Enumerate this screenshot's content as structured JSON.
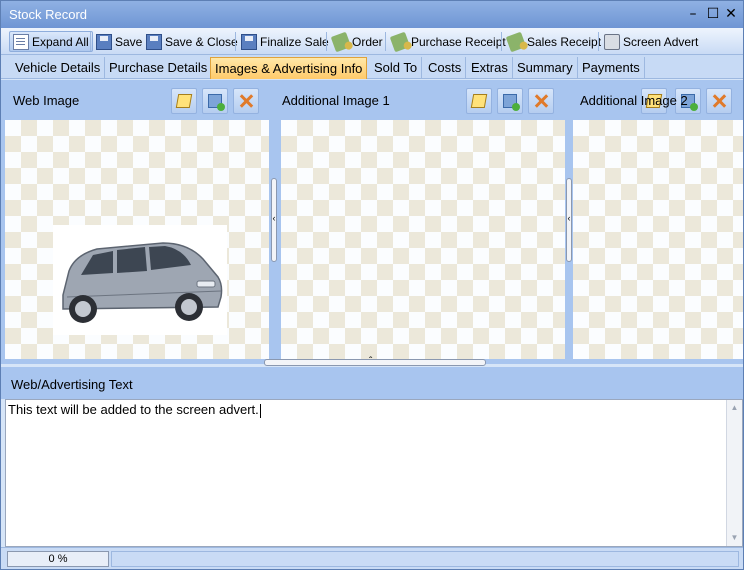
{
  "window": {
    "title": "Stock Record",
    "controls": [
      "minimize",
      "maximize",
      "close"
    ]
  },
  "toolbar": {
    "buttons": [
      {
        "label": "Expand All",
        "icon": "document-icon"
      },
      {
        "label": "Save",
        "icon": "save-icon"
      },
      {
        "label": "Save & Close",
        "icon": "save-icon"
      },
      {
        "label": "Finalize Sale",
        "icon": "save-icon"
      },
      {
        "label": "Order",
        "icon": "money-icon"
      },
      {
        "label": "Purchase Receipt",
        "icon": "money-icon"
      },
      {
        "label": "Sales Receipt",
        "icon": "money-icon"
      },
      {
        "label": "Screen Advert",
        "icon": "printer-icon"
      }
    ]
  },
  "tabs": [
    {
      "label": "Vehicle Details"
    },
    {
      "label": "Purchase Details"
    },
    {
      "label": "Images & Advertising Info",
      "active": true
    },
    {
      "label": "Sold To"
    },
    {
      "label": "Costs"
    },
    {
      "label": "Extras"
    },
    {
      "label": "Summary"
    },
    {
      "label": "Payments"
    }
  ],
  "images": {
    "panels": [
      {
        "label": "Web Image"
      },
      {
        "label": "Additional Image 1"
      },
      {
        "label": "Additional Image 2"
      }
    ]
  },
  "advert": {
    "label": "Web/Advertising Text",
    "text": "This text will be added to the screen advert."
  },
  "status": {
    "progress": "0 %",
    "progress_value": 0
  },
  "colors": {
    "accent_tab": "#ffca6a",
    "panel_bg": "#a8c5ef",
    "titlebar": "#7a9ed8"
  }
}
